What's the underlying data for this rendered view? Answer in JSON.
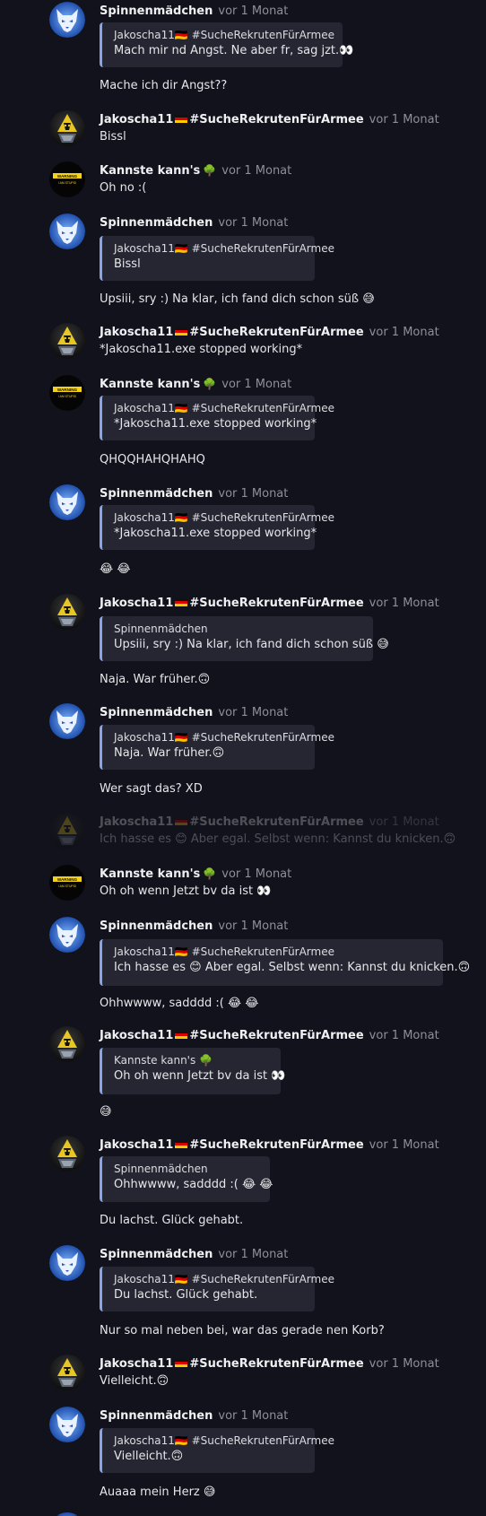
{
  "users": {
    "spinne": "Spinnenmädchen",
    "jako": "Jakoscha11",
    "jako_tag": "#SucheRekrutenFürArmee",
    "kann": "Kannste kann's"
  },
  "avatar_labels": {
    "warning": "WARNING",
    "stupid": "I AM STUPID"
  },
  "icons": {
    "flag": "germany-flag-icon",
    "tree": "tree-icon",
    "avatar_wolf": "wolf-avatar",
    "avatar_warning": "warning-avatar",
    "avatar_gold": "gold-emblem-avatar"
  },
  "messages": [
    {
      "time": "vor 1 Monat",
      "quote_author": "Jakoscha11🇩🇪 #SucheRekrutenFürArmee",
      "quote_text": "Mach mir nd Angst. Ne aber fr, sag jzt.👀",
      "text": "Mache ich dir Angst??"
    },
    {
      "time": "vor 1 Monat",
      "text": "Bissl"
    },
    {
      "time": "vor 1 Monat",
      "text": "Oh no :("
    },
    {
      "time": "vor 1 Monat",
      "quote_author": "Jakoscha11🇩🇪 #SucheRekrutenFürArmee",
      "quote_text": "Bissl",
      "text": "Upsiii, sry :) Na klar, ich fand dich schon süß 😅"
    },
    {
      "time": "vor 1 Monat",
      "text": "*Jakoscha11.exe stopped working*"
    },
    {
      "time": "vor 1 Monat",
      "quote_author": "Jakoscha11🇩🇪 #SucheRekrutenFürArmee",
      "quote_text": "*Jakoscha11.exe stopped working*",
      "text": "QHQQHAHQHAHQ"
    },
    {
      "time": "vor 1 Monat",
      "quote_author": "Jakoscha11🇩🇪 #SucheRekrutenFürArmee",
      "quote_text": "*Jakoscha11.exe stopped working*",
      "text": "😂 😂"
    },
    {
      "time": "vor 1 Monat",
      "quote_author": "Spinnenmädchen",
      "quote_text": "Upsiii, sry :) Na klar, ich fand dich schon süß 😅",
      "text": "Naja. War früher.🙃"
    },
    {
      "time": "vor 1 Monat",
      "quote_author": "Jakoscha11🇩🇪 #SucheRekrutenFürArmee",
      "quote_text": "Naja. War früher.🙃",
      "text": "Wer sagt das? XD"
    },
    {
      "time": "vor 1 Monat",
      "text": "Ich hasse es 😊 Aber egal. Selbst wenn: Kannst du knicken.🙃"
    },
    {
      "time": "vor 1 Monat",
      "text": "Oh oh wenn Jetzt bv da ist 👀"
    },
    {
      "time": "vor 1 Monat",
      "quote_author": "Jakoscha11🇩🇪 #SucheRekrutenFürArmee",
      "quote_text": "Ich hasse es 😊 Aber egal. Selbst wenn: Kannst du knicken.🙃",
      "text": "Ohhwwww, sadddd :( 😂 😂"
    },
    {
      "time": "vor 1 Monat",
      "quote_author": "Kannste kann's 🌳",
      "quote_text": "Oh oh wenn Jetzt bv da ist 👀",
      "text": "😅"
    },
    {
      "time": "vor 1 Monat",
      "quote_author": "Spinnenmädchen",
      "quote_text": "Ohhwwww, sadddd :( 😂 😂",
      "text": "Du lachst. Glück gehabt."
    },
    {
      "time": "vor 1 Monat",
      "quote_author": "Jakoscha11🇩🇪 #SucheRekrutenFürArmee",
      "quote_text": "Du lachst. Glück gehabt.",
      "text": "Nur so mal neben bei, war das gerade nen Korb?"
    },
    {
      "time": "vor 1 Monat",
      "text": "Vielleicht.🙃"
    },
    {
      "time": "vor 1 Monat",
      "quote_author": "Jakoscha11🇩🇪 #SucheRekrutenFürArmee",
      "quote_text": "Vielleicht.🙃",
      "text": "Auaaa mein Herz 😅"
    }
  ]
}
